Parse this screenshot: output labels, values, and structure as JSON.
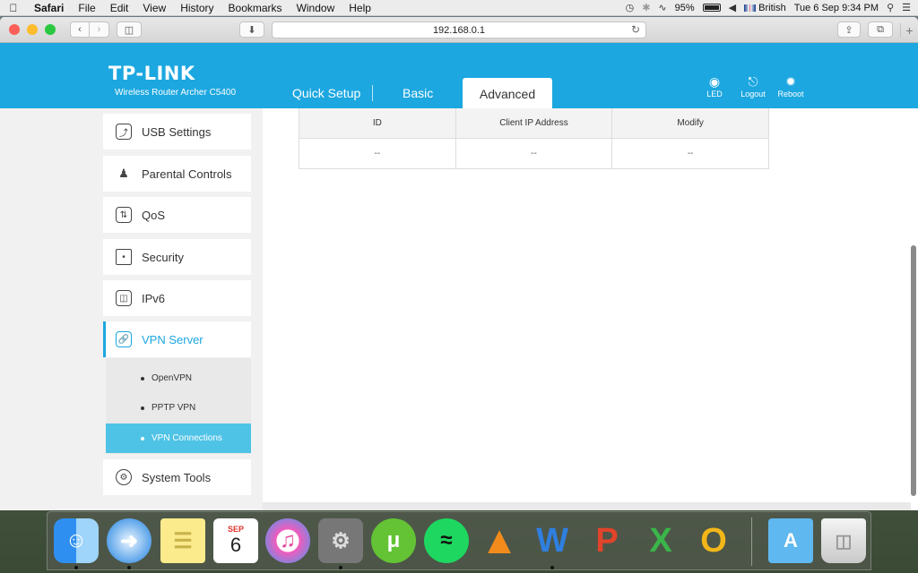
{
  "menubar": {
    "app_name": "Safari",
    "items": [
      "File",
      "Edit",
      "View",
      "History",
      "Bookmarks",
      "Window",
      "Help"
    ],
    "battery": "95%",
    "input_source": "British",
    "datetime": "Tue 6 Sep  9:34 PM"
  },
  "browser": {
    "url": "192.168.0.1"
  },
  "router": {
    "logo": "TP-LINK",
    "model": "Wireless Router Archer C5400",
    "nav": [
      "Quick Setup",
      "Basic",
      "Advanced"
    ],
    "header_icons": [
      {
        "label": "LED",
        "icon": "led-icon"
      },
      {
        "label": "Logout",
        "icon": "logout-icon"
      },
      {
        "label": "Reboot",
        "icon": "reboot-icon"
      }
    ]
  },
  "sidebar": {
    "items": [
      {
        "label": "USB Settings",
        "icon": "usb-icon"
      },
      {
        "label": "Parental Controls",
        "icon": "family-icon"
      },
      {
        "label": "QoS",
        "icon": "qos-icon"
      },
      {
        "label": "Security",
        "icon": "lock-icon"
      },
      {
        "label": "IPv6",
        "icon": "ipv6-icon"
      },
      {
        "label": "VPN Server",
        "icon": "vpn-icon"
      },
      {
        "label": "System Tools",
        "icon": "gear-icon"
      }
    ],
    "subitems": [
      "OpenVPN",
      "PPTP VPN",
      "VPN Connections"
    ]
  },
  "table": {
    "headers": [
      "ID",
      "Client IP Address",
      "Modify"
    ],
    "rows": [
      [
        "--",
        "--",
        "--"
      ]
    ]
  },
  "dock": {
    "apps": [
      "finder-icon",
      "safari-icon",
      "notes-icon",
      "calendar-icon",
      "itunes-icon",
      "system-preferences-icon",
      "utorrent-icon",
      "spotify-icon",
      "vlc-icon",
      "word-icon",
      "powerpoint-icon",
      "excel-icon",
      "outlook-icon",
      "applications-folder-icon",
      "trash-icon"
    ],
    "calendar_month": "SEP",
    "calendar_day": "6"
  },
  "colors": {
    "brand": "#1ca7e0",
    "active_sub": "#4fc3e6"
  }
}
